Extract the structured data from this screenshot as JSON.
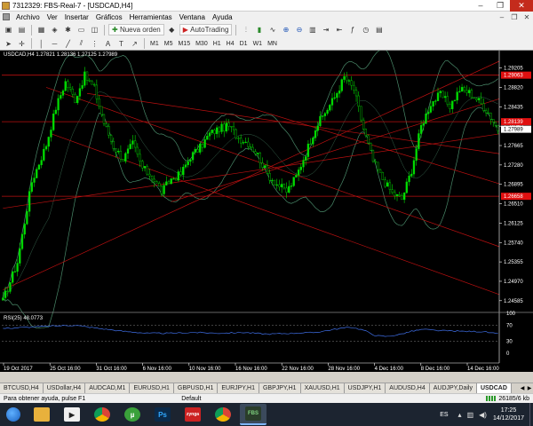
{
  "window": {
    "title": "7312329: FBS-Real-7 - [USDCAD,H4]",
    "controls": [
      "–",
      "❐",
      "✕"
    ]
  },
  "menu": {
    "items": [
      "Archivo",
      "Ver",
      "Insertar",
      "Gráficos",
      "Herramientas",
      "Ventana",
      "Ayuda"
    ],
    "right_controls": [
      "–",
      "❐",
      "✕"
    ]
  },
  "toolbar1": {
    "new_order_label": "Nueva orden",
    "autotrading_label": "AutoTrading"
  },
  "toolbar2": {
    "timeframes": [
      "M1",
      "M5",
      "M15",
      "M30",
      "H1",
      "H4",
      "D1",
      "W1",
      "MN"
    ],
    "active_timeframe": "H4"
  },
  "chart": {
    "symbol_info": "USDCAD,H4  1.27821 1.28136 1.27125 1.27989",
    "rsi_info": "RSI(25) 48.0773",
    "colors": {
      "background": "#000000",
      "candle": "#00dd00",
      "bands": "#4a8a6a",
      "trendlines": "#bb1010",
      "rsi": "#3f6fe8",
      "rsi_level": "#808080",
      "price_label_red": "#e01010",
      "current_price_bg": "#ffffff"
    }
  },
  "chart_data": {
    "type": "candlestick",
    "symbol": "USDCAD",
    "timeframe": "H4",
    "price_axis_ticks": [
      1.29205,
      1.2882,
      1.28435,
      1.2805,
      1.27665,
      1.2728,
      1.26895,
      1.2651,
      1.26125,
      1.2574,
      1.25355,
      1.2497,
      1.24585
    ],
    "highlighted_price_labels": [
      "1.29063",
      "1.28139",
      "1.27989",
      "1.26658"
    ],
    "time_axis_labels": [
      "19 Oct 2017",
      "25 Oct 16:00",
      "31 Oct 16:00",
      "6 Nov 16:00",
      "10 Nov 16:00",
      "16 Nov 16:00",
      "22 Nov 16:00",
      "28 Nov 16:00",
      "4 Dec 16:00",
      "8 Dec 16:00",
      "14 Dec 16:00"
    ],
    "ylim": [
      1.2437,
      1.2948
    ],
    "close_path_keypoints": [
      [
        0,
        1.2458
      ],
      [
        6,
        1.2535
      ],
      [
        12,
        1.2695
      ],
      [
        18,
        1.2768
      ],
      [
        22,
        1.2842
      ],
      [
        26,
        1.2893
      ],
      [
        30,
        1.2858
      ],
      [
        34,
        1.2905
      ],
      [
        38,
        1.288
      ],
      [
        42,
        1.2812
      ],
      [
        46,
        1.2765
      ],
      [
        50,
        1.274
      ],
      [
        54,
        1.277
      ],
      [
        58,
        1.2722
      ],
      [
        62,
        1.2705
      ],
      [
        66,
        1.2675
      ],
      [
        70,
        1.27
      ],
      [
        74,
        1.271
      ],
      [
        78,
        1.2745
      ],
      [
        82,
        1.2762
      ],
      [
        86,
        1.279
      ],
      [
        90,
        1.28
      ],
      [
        94,
        1.2805
      ],
      [
        98,
        1.2782
      ],
      [
        102,
        1.2772
      ],
      [
        106,
        1.2748
      ],
      [
        110,
        1.271
      ],
      [
        114,
        1.269
      ],
      [
        118,
        1.2675
      ],
      [
        122,
        1.2705
      ],
      [
        126,
        1.2752
      ],
      [
        130,
        1.2802
      ],
      [
        134,
        1.2832
      ],
      [
        138,
        1.2862
      ],
      [
        142,
        1.2902
      ],
      [
        146,
        1.2878
      ],
      [
        150,
        1.28
      ],
      [
        154,
        1.2735
      ],
      [
        158,
        1.27
      ],
      [
        162,
        1.2672
      ],
      [
        166,
        1.266
      ],
      [
        170,
        1.2718
      ],
      [
        174,
        1.2805
      ],
      [
        178,
        1.285
      ],
      [
        182,
        1.2868
      ],
      [
        186,
        1.2845
      ],
      [
        190,
        1.2878
      ],
      [
        194,
        1.2872
      ],
      [
        198,
        1.2855
      ],
      [
        202,
        1.2832
      ],
      [
        206,
        1.2799
      ]
    ],
    "rsi": {
      "name": "RSI(25)",
      "current": 48.0773,
      "levels": [
        70,
        30
      ],
      "axis_ticks": [
        100,
        70,
        30,
        0
      ],
      "keypoints": [
        [
          0,
          62
        ],
        [
          20,
          68
        ],
        [
          30,
          70
        ],
        [
          40,
          62
        ],
        [
          50,
          55
        ],
        [
          60,
          50
        ],
        [
          70,
          50
        ],
        [
          80,
          52
        ],
        [
          90,
          50
        ],
        [
          100,
          52
        ],
        [
          110,
          48
        ],
        [
          120,
          50
        ],
        [
          130,
          52
        ],
        [
          140,
          62
        ],
        [
          145,
          65
        ],
        [
          150,
          58
        ],
        [
          155,
          44
        ],
        [
          160,
          42
        ],
        [
          165,
          47
        ],
        [
          170,
          55
        ],
        [
          175,
          60
        ],
        [
          180,
          57
        ],
        [
          190,
          55
        ],
        [
          200,
          54
        ],
        [
          206,
          48
        ]
      ]
    }
  },
  "tabs": {
    "items": [
      "BTCUSD,H4",
      "USDollar,H4",
      "AUDCAD,M1",
      "EURUSD,H1",
      "GBPUSD,H1",
      "EURJPY,H1",
      "GBPJPY,H1",
      "XAUUSD,H1",
      "USDJPY,H1",
      "AUDUSD,H4",
      "AUDJPY,Daily",
      "USDCAD"
    ],
    "active_index": 11
  },
  "status": {
    "help": "Para obtener ayuda, pulse F1",
    "profile": "Default",
    "traffic": "26185/6 kb"
  },
  "taskbar": {
    "apps": [
      {
        "name": "explorer",
        "label": ""
      },
      {
        "name": "media",
        "label": "▶"
      },
      {
        "name": "chrome",
        "label": ""
      },
      {
        "name": "torrent",
        "label": "µ"
      },
      {
        "name": "photoshop",
        "label": "Ps"
      },
      {
        "name": "zynga",
        "label": "zynga"
      },
      {
        "name": "chrome2",
        "label": ""
      },
      {
        "name": "fbs",
        "label": "FBS"
      }
    ],
    "language": "ES",
    "time": "17:25",
    "date": "14/12/2017"
  }
}
